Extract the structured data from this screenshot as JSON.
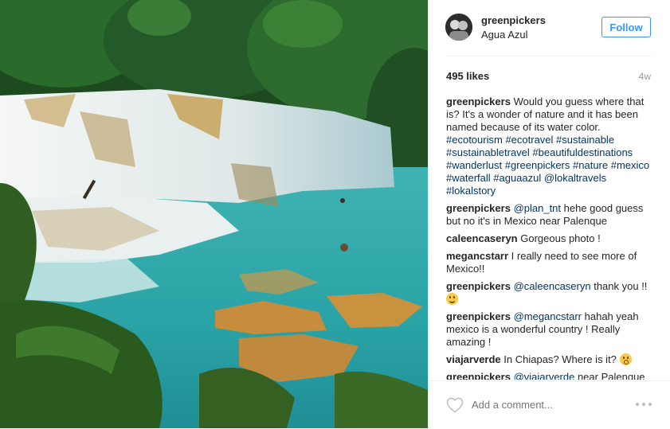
{
  "post": {
    "username": "greenpickers",
    "location": "Agua Azul",
    "follow_label": "Follow",
    "likes": "495 likes",
    "time": "4w",
    "caption_user": "greenpickers",
    "caption_text": "Would you guess where that is? It's a wonder of nature and it has been named because of its water color.",
    "caption_tags": [
      "#ecotourism",
      "#ecotravel",
      "#sustainable",
      "#sustainabletravel",
      "#beautifuldestinations",
      "#wanderlust",
      "#greenpickers",
      "#nature",
      "#mexico",
      "#waterfall",
      "#aguaazul",
      "@lokaltravels",
      "#lokalstory"
    ],
    "add_comment_placeholder": "Add a comment...",
    "comment_1_user": "greenpickers",
    "comment_1_mention": "@plan_tnt",
    "comment_1_text": " hehe good guess but no it's in Mexico near Palenque",
    "comment_2_user": "caleencaseryn",
    "comment_2_text": " Gorgeous photo !",
    "comment_3_user": "megancstarr",
    "comment_3_text": " I really need to see more of Mexico!!",
    "comment_4_user": "greenpickers",
    "comment_4_mention": "@caleencaseryn",
    "comment_4_text": " thank you !! ",
    "comment_5_user": "greenpickers",
    "comment_5_mention": "@megancstarr",
    "comment_5_text": " hahah yeah mexico is a wonderful country ! Really amazing !",
    "comment_6_user": "viajarverde",
    "comment_6_text": " In Chiapas? Where is it? ",
    "comment_7_user": "greenpickers",
    "comment_7_mention": "@viajarverde",
    "comment_7_text": " near Palenque"
  },
  "colors": {
    "link": "#003569",
    "accent": "#3897f0"
  }
}
